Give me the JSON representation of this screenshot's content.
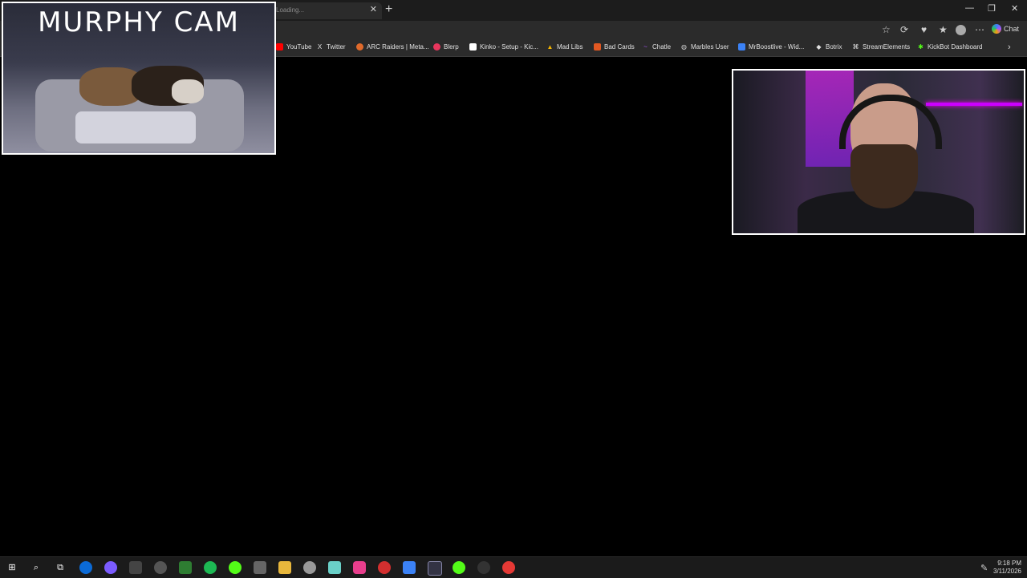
{
  "browser": {
    "tab_title": "Loading...",
    "close_tab": "✕",
    "new_tab": "+",
    "chat_label": "Chat"
  },
  "bookmarks": [
    {
      "label": "YouTube",
      "icon": "youtube-icon",
      "color": "#ff0000"
    },
    {
      "label": "Twitter",
      "icon": "x-icon",
      "color": "#ffffff"
    },
    {
      "label": "ARC Raiders | Meta...",
      "icon": "arc-icon",
      "color": "#e06a2b"
    },
    {
      "label": "Blerp",
      "icon": "blerp-icon",
      "color": "#e8365d"
    },
    {
      "label": "Kinko - Setup - Kic...",
      "icon": "kinko-icon",
      "color": "#ffffff"
    },
    {
      "label": "Mad Libs",
      "icon": "madlibs-icon",
      "color": "#f4b400"
    },
    {
      "label": "Bad Cards",
      "icon": "badcards-icon",
      "color": "#e25822"
    },
    {
      "label": "Chatle",
      "icon": "chatle-icon",
      "color": "#a855f7"
    },
    {
      "label": "Marbles User",
      "icon": "globe-icon",
      "color": "#cccccc"
    },
    {
      "label": "MrBoostlive - Wid...",
      "icon": "mrboost-icon",
      "color": "#3b82f6"
    },
    {
      "label": "Botrix",
      "icon": "botrix-icon",
      "color": "#ffffff"
    },
    {
      "label": "StreamElements",
      "icon": "streamelements-icon",
      "color": "#ffffff"
    },
    {
      "label": "KickBot Dashboard",
      "icon": "kickbot-icon",
      "color": "#53fc18"
    }
  ],
  "overlays": {
    "murphy_title": "MURPHY CAM"
  },
  "taskbar": {
    "time": "9:18 PM",
    "date": "3/11/2026"
  }
}
